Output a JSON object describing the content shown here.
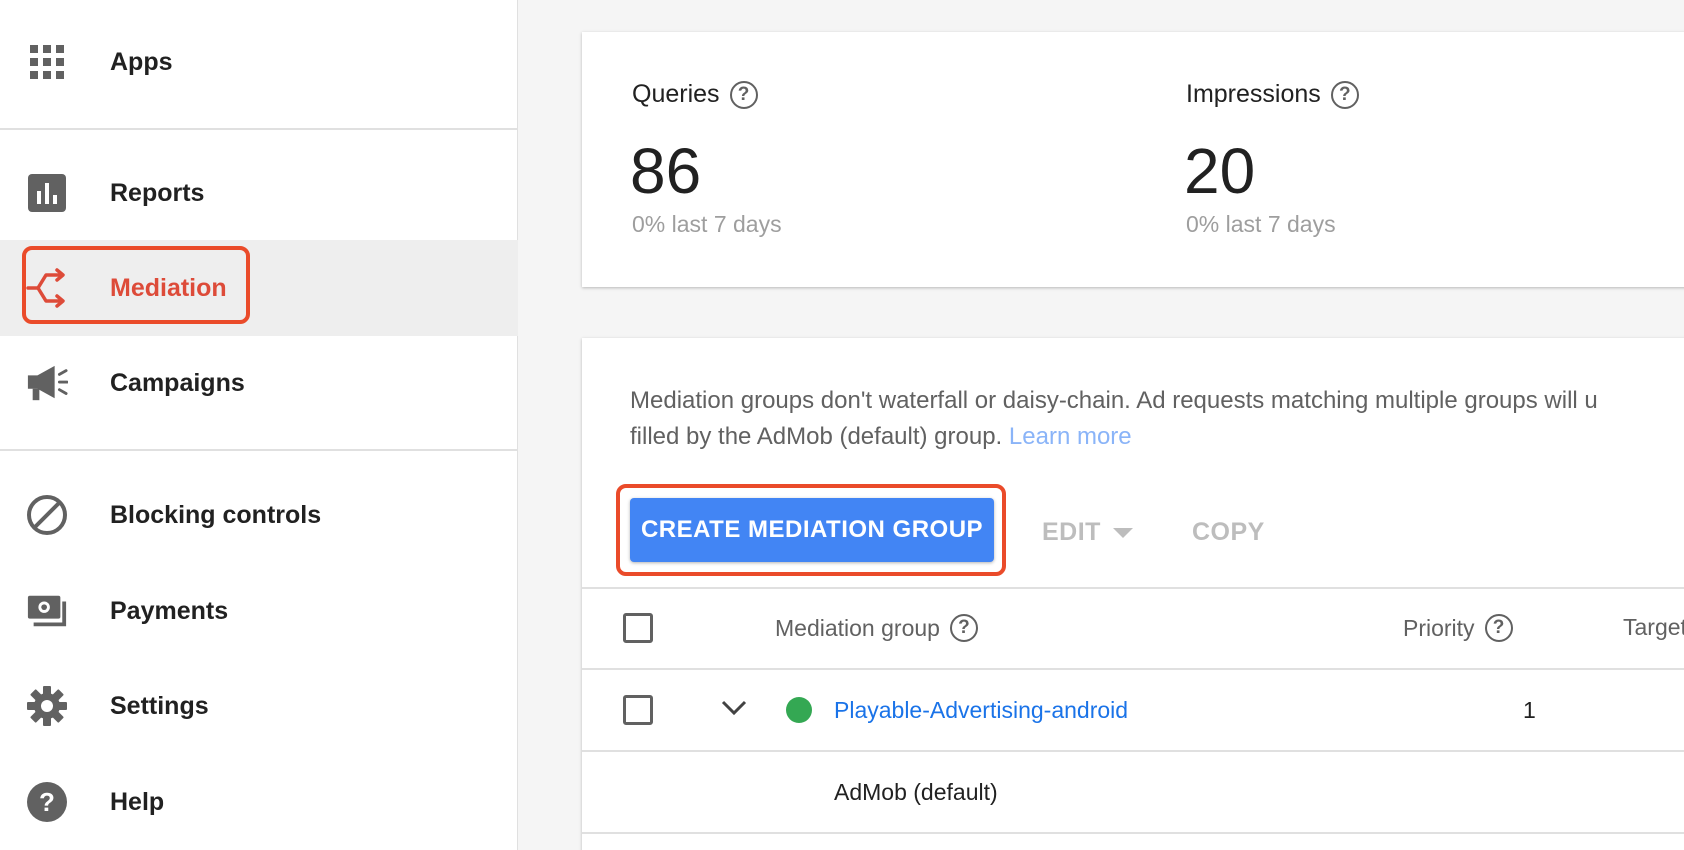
{
  "sidebar": {
    "items": [
      {
        "label": "Apps",
        "icon": "apps-grid-icon"
      },
      {
        "label": "Reports",
        "icon": "bar-chart-icon"
      },
      {
        "label": "Mediation",
        "icon": "mediation-icon",
        "active": true
      },
      {
        "label": "Campaigns",
        "icon": "megaphone-icon"
      },
      {
        "label": "Blocking controls",
        "icon": "block-icon"
      },
      {
        "label": "Payments",
        "icon": "payments-icon"
      },
      {
        "label": "Settings",
        "icon": "gear-icon"
      },
      {
        "label": "Help",
        "icon": "help-icon"
      }
    ]
  },
  "stats": {
    "queries": {
      "label": "Queries",
      "value": "86",
      "sub": "0% last 7 days"
    },
    "impressions": {
      "label": "Impressions",
      "value": "20",
      "sub": "0% last 7 days"
    }
  },
  "mediation": {
    "description_line1": "Mediation groups don't waterfall or daisy-chain. Ad requests matching multiple groups will u",
    "description_line2": "filled by the AdMob (default) group.",
    "learn_more": "Learn more",
    "create_button": "CREATE MEDIATION GROUP",
    "edit_button": "EDIT",
    "copy_button": "COPY",
    "table": {
      "headers": {
        "group": "Mediation group",
        "priority": "Priority",
        "targeting": "Target"
      },
      "rows": [
        {
          "name": "Playable-Advertising-android",
          "priority": "1",
          "status": "active"
        },
        {
          "name": "AdMob (default)",
          "priority": ""
        }
      ]
    }
  },
  "colors": {
    "accent": "#4285f4",
    "highlight": "#ea4b2a",
    "active_nav": "#dd4b39",
    "status_active": "#34a853"
  }
}
